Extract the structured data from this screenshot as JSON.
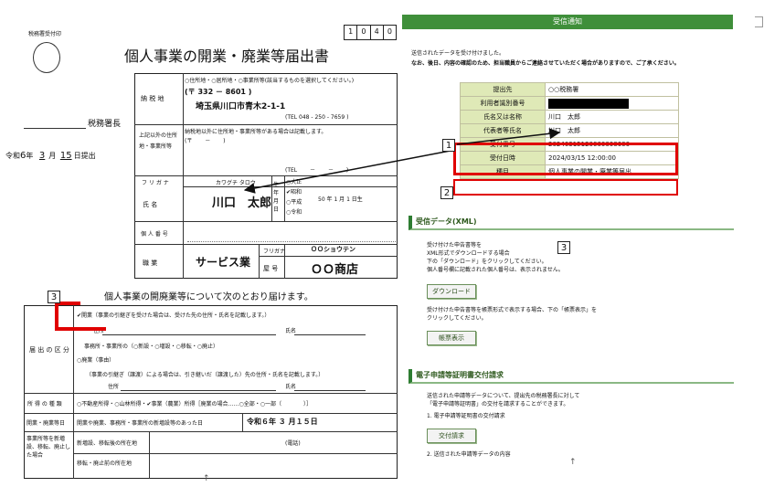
{
  "form": {
    "stamp_label": "税務署受付印",
    "form_no": [
      "1",
      "0",
      "4",
      "0"
    ],
    "title": "個人事業の開業・廃業等届出書",
    "tax_office_suffix": "税務署長",
    "date_prefix": "令和",
    "date_year": "6",
    "date_year_unit": "年",
    "date_month": "3",
    "date_month_unit": "月",
    "date_day": "15",
    "date_suffix": "日提出",
    "address_label": "納 税 地",
    "address_choice": "○住所地・○居所地・○事業所等(該当するものを選択してください。)",
    "postal": "(〒 332 － 8601 )",
    "address": "埼玉県川口市青木2-1-1",
    "tel": "(TEL 048 - 250 - 7659 )",
    "other_address_label": "上記以外の住所地・事業所等",
    "other_address_note": "納税地以外に住所地・事業所等がある場合は記載します。",
    "other_postal": "(〒　　 －　　 )",
    "other_tel": "(TEL　　 －　　 －　　 )",
    "furigana_label": "フ リ ガ ナ",
    "furigana": "カワグチ タロウ",
    "name_label": "氏 名",
    "name": "川口　太郎",
    "birth_label": "生年月日",
    "era_options": [
      "○大正",
      "✔昭和",
      "○平成",
      "○令和"
    ],
    "birth_date": "50 年 1 月 1 日生",
    "mynumber_label": "個 人 番 号",
    "job_label": "職 業",
    "job": "サービス業",
    "shop_furigana_label": "フリガナ",
    "shop_furigana": "ＯＯショウテン",
    "shop_label": "屋 号",
    "shop": "ＯＯ商店",
    "notice": "個人事業の開廃業等について次のとおり届けます。",
    "kubun_label": "届 出 の 区 分",
    "opt_open": "✔開業（事業の引継ぎを受けた場合は、受けた先の住所・氏名を記載します。）",
    "opt_open_addr": "住所",
    "opt_open_name": "氏名",
    "opt_office": "事務所・事業所の（○新設・○増設・○移転・○廃止）",
    "opt_close": "○廃業（事由）",
    "opt_close_note": "（事業の引継ぎ（譲渡）による場合は、引き継いだ（譲渡した）先の住所・氏名を記載します。）",
    "opt_close_addr": "住所",
    "opt_close_name": "氏名",
    "income_label": "所 得 の 種 類",
    "income_value": "○不動産所得・○山林所得・✔事業（農業）所得［廃業の場合……○全部・○一部（　　　　）］",
    "open_date_label": "開業・廃業等日",
    "open_date_text": "開業や廃業、事務所・事業所の新増設等のあった日",
    "open_date_value": "令和６年 ３ 月１５日",
    "office_label": "事業所等を新増設、移転、廃止した場合",
    "office_row1": "新増設、移転後の所在地",
    "office_row1_tel": "(電話)",
    "office_row2": "移転・廃止前の所在地"
  },
  "callouts": [
    "1",
    "2",
    "3",
    "3"
  ],
  "panel": {
    "title": "受信通知",
    "intro1": "送信されたデータを受け付けました。",
    "intro2": "なお、後日、内容の確認のため、担当職員からご連絡させていただく場合がありますので、ご了承ください。",
    "rows": [
      {
        "key": "提出先",
        "value": "○○税務署"
      },
      {
        "key": "利用者識別番号",
        "value": ""
      },
      {
        "key": "氏名又は名称",
        "value": "川口　太郎"
      },
      {
        "key": "代表者等氏名",
        "value": "川口　太郎"
      },
      {
        "key": "受付番号",
        "value": "20240315120000000000"
      },
      {
        "key": "受付日時",
        "value": "2024/03/15 12:00:00"
      },
      {
        "key": "種目",
        "value": "個人事業の開業・廃業等届出"
      }
    ],
    "xml_title": "受信データ(XML)",
    "xml_text1": "受け付けた申告書等を",
    "xml_text2": "XML形式でダウンロードする場合",
    "xml_text3": "下の「ダウンロード」をクリックしてください。",
    "xml_text4": "個人番号欄に記載された個人番号は、表示されません。",
    "download_label": "ダウンロード",
    "form_text1": "受け付けた申告書等を帳票形式で表示する場合、下の「帳票表示」を",
    "form_text2": "クリックしてください。",
    "form_btn_label": "帳票表示",
    "cert_title": "電子申請等証明書交付請求",
    "cert_text1": "送信された申請等データについて、提出先の税務署長に対して",
    "cert_text2": "「電子申請等証明書」の交付を請求することができます。",
    "cert_text3": "1. 電子申請等証明書の交付請求",
    "cert_btn_label": "交付請求",
    "cert_text4": "2. 送信された申請等データの内容"
  },
  "colors": {
    "accent_green": "#3f8f3a",
    "highlight_red": "#e00000",
    "table_key_bg": "#dfe9b7"
  }
}
